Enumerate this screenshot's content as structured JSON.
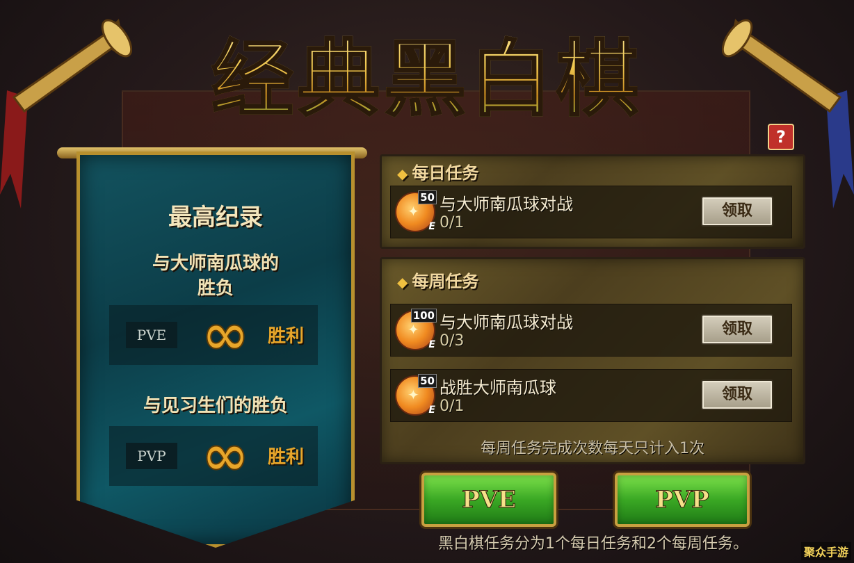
{
  "title": "经典黑白棋",
  "help_label": "?",
  "record_panel": {
    "heading": "最高纪录",
    "vs_master_line1": "与大师南瓜球的",
    "vs_master_line2": "胜负",
    "pve": {
      "mode": "PVE",
      "score": "∞",
      "suffix": "胜利"
    },
    "vs_trainee": "与见习生们的胜负",
    "pvp": {
      "mode": "PVP",
      "score": "∞",
      "suffix": "胜利"
    }
  },
  "daily_tasks": {
    "heading": "每日任务",
    "items": [
      {
        "reward": "50",
        "name": "与大师南瓜球对战",
        "progress": "0/1",
        "button": "领取"
      }
    ]
  },
  "weekly_tasks": {
    "heading": "每周任务",
    "items": [
      {
        "reward": "100",
        "name": "与大师南瓜球对战",
        "progress": "0/3",
        "button": "领取"
      },
      {
        "reward": "50",
        "name": "战胜大师南瓜球",
        "progress": "0/1",
        "button": "领取"
      }
    ],
    "note": "每周任务完成次数每天只计入1次"
  },
  "buttons": {
    "pve": "PVE",
    "pvp": "PVP"
  },
  "footer": "黑白棋任务分为1个每日任务和2个每周任务。",
  "watermark": "聚众手游",
  "colors": {
    "gold": "#e8a62a",
    "teal": "#0c3d48",
    "green": "#3aa824"
  }
}
